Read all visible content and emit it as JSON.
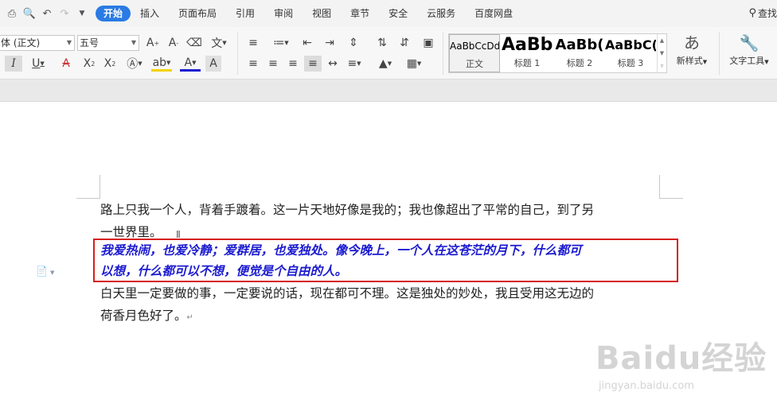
{
  "menu": {
    "tabs": [
      "开始",
      "插入",
      "页面布局",
      "引用",
      "审阅",
      "视图",
      "章节",
      "安全",
      "云服务",
      "百度网盘"
    ],
    "active_tab": "开始",
    "find_label": "查找"
  },
  "ribbon": {
    "font_family": "体 (正文)",
    "font_size": "五号",
    "styles": [
      {
        "preview": "AaBbCcDd",
        "name": "正文"
      },
      {
        "preview": "AaBb",
        "name": "标题 1"
      },
      {
        "preview": "AaBb(",
        "name": "标题 2"
      },
      {
        "preview": "AaBbC(",
        "name": "标题 3"
      }
    ],
    "new_style_label": "新样式",
    "text_tools_label": "文字工具"
  },
  "document": {
    "para1_line1": "路上只我一个人，背着手踱着。这一片天地好像是我的；我也像超出了平常的自己，到了另",
    "para1_line2": "一世界里。",
    "highlight_line1": "我爱热闹，也爱冷静；爱群居，也爱独处。像今晚上，一个人在这苍茫的月下，什么都可",
    "highlight_line2": "以想，什么都可以不想，便觉是个自由的人。",
    "para3_line1": "白天里一定要做的事，一定要说的话，现在都可不理。这是独处的妙处，我且受用这无边的",
    "para3_line2": "荷香月色好了。"
  },
  "watermark": {
    "brand": "Baidu经验",
    "url": "jingyan.baidu.com"
  },
  "colors": {
    "accent": "#2a7be4",
    "highlight_border": "#d61f1f",
    "highlight_text": "#1b1bd0"
  }
}
